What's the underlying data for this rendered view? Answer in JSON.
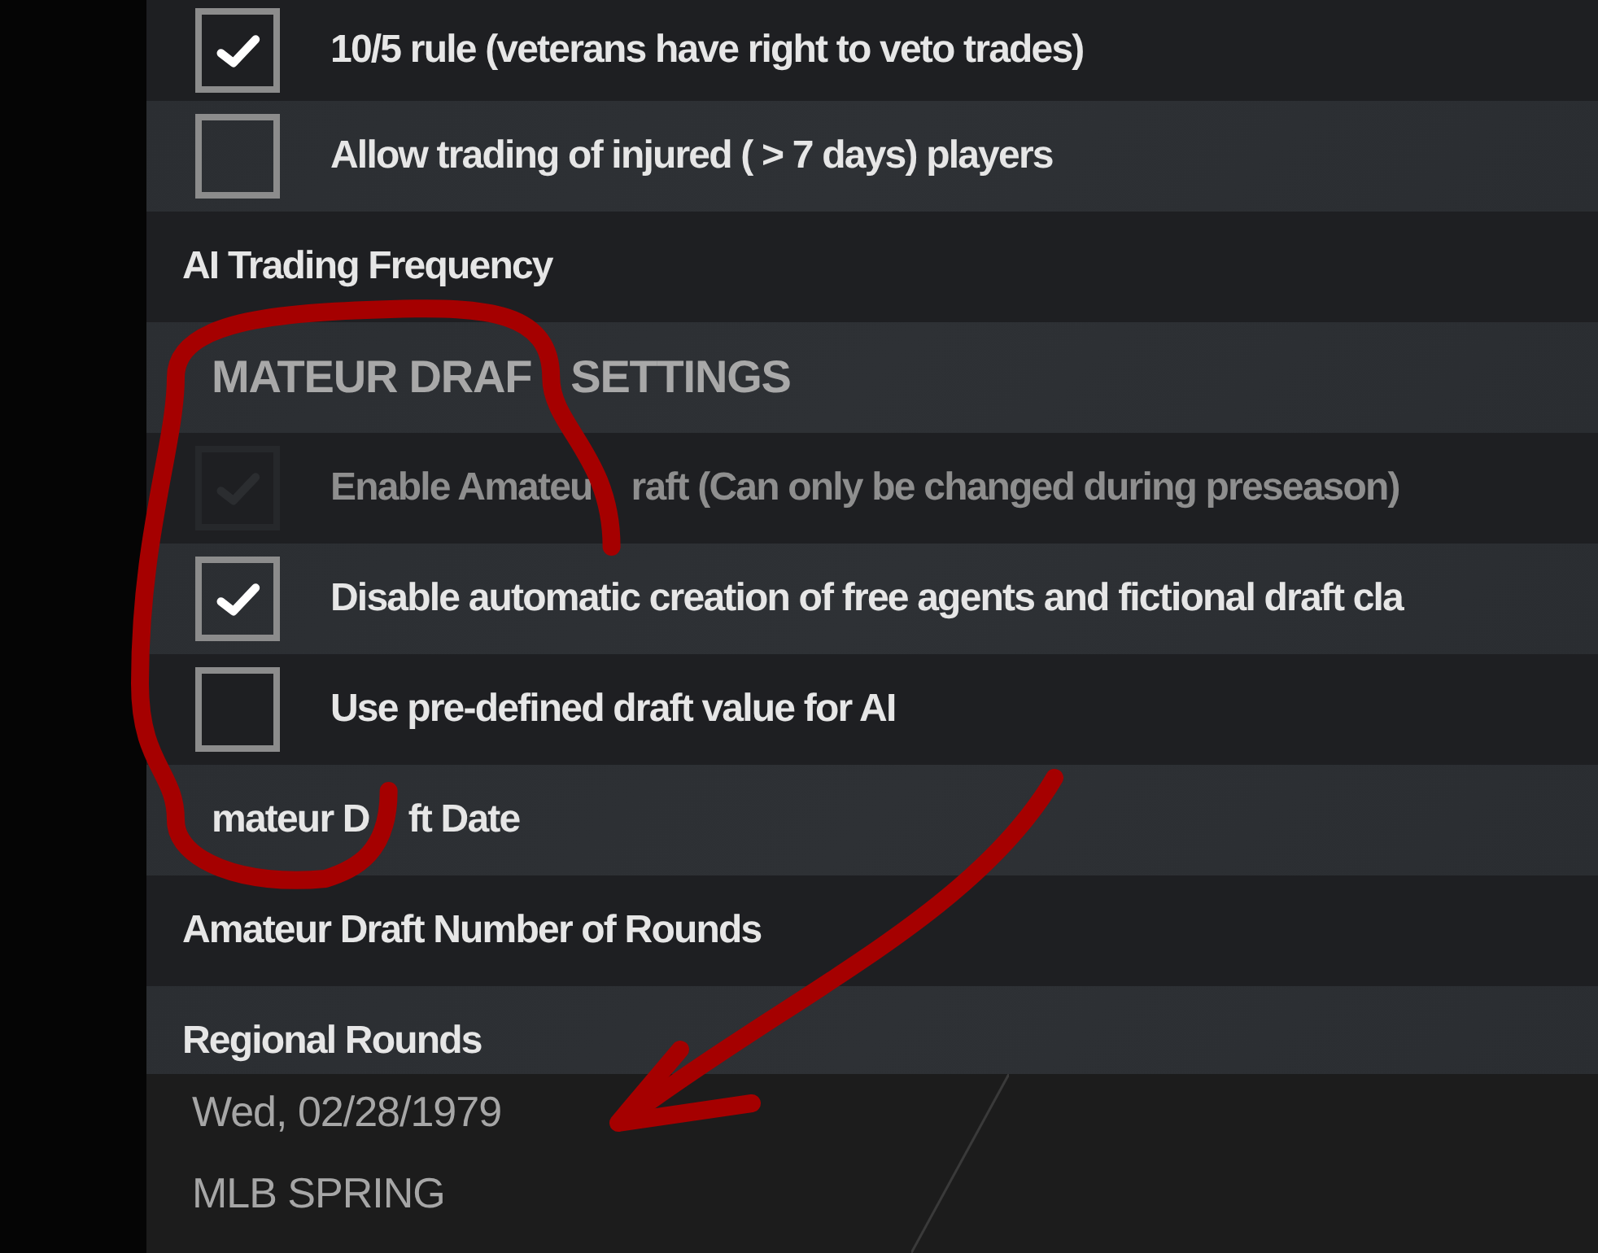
{
  "settings": [
    {
      "kind": "checkbox",
      "label": "10/5 rule (veterans have right to veto trades)",
      "checked": true,
      "disabled": false
    },
    {
      "kind": "checkbox",
      "label": "Allow trading of injured ( > 7 days) players",
      "checked": false,
      "disabled": false
    },
    {
      "kind": "setting",
      "label": "AI Trading Frequency"
    },
    {
      "kind": "header",
      "segments": [
        "MATEUR DRAF",
        "SETTINGS"
      ]
    },
    {
      "kind": "checkbox",
      "segments": [
        "Enable Amateu",
        "raft (Can only be changed during preseason)"
      ],
      "checked": true,
      "disabled": true
    },
    {
      "kind": "checkbox",
      "label": "Disable automatic creation of free agents and fictional draft cla",
      "checked": true,
      "disabled": false
    },
    {
      "kind": "checkbox",
      "label": "Use pre-defined draft value for AI",
      "checked": false,
      "disabled": false
    },
    {
      "kind": "setting",
      "segments": [
        "mateur D",
        "ft Date"
      ]
    },
    {
      "kind": "setting",
      "label": "Amateur Draft Number of Rounds"
    },
    {
      "kind": "setting",
      "label": "Regional Rounds"
    }
  ],
  "status": {
    "date": "Wed, 02/28/1979",
    "phase": "MLB SPRING"
  }
}
